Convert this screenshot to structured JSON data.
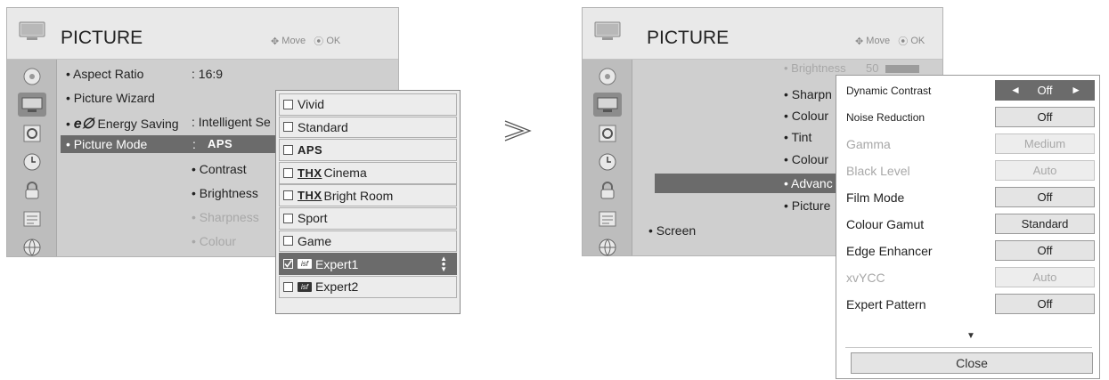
{
  "left": {
    "title": "PICTURE",
    "nav_hint": {
      "move": "Move",
      "ok": "OK"
    },
    "menu": {
      "aspect_ratio": {
        "label": "Aspect Ratio",
        "value": ": 16:9"
      },
      "picture_wizard": {
        "label": "Picture Wizard"
      },
      "energy_saving": {
        "prefix": "e∅",
        "label": "Energy Saving",
        "value": ": Intelligent Se"
      },
      "picture_mode": {
        "label": "Picture Mode",
        "value": ":",
        "value_logo": "APS"
      },
      "contrast": "• Contrast",
      "brightness": "• Brightness",
      "sharpness": "• Sharpness",
      "colour": "• Colour"
    }
  },
  "dropdown": {
    "options": [
      {
        "label": "Vivid",
        "checked": false,
        "selected": false
      },
      {
        "label": "Standard",
        "checked": false,
        "selected": false
      },
      {
        "label": "APS",
        "checked": false,
        "selected": false
      },
      {
        "logo": "THX",
        "label": "Cinema",
        "checked": false,
        "selected": false
      },
      {
        "logo": "THX",
        "label": " Bright Room",
        "checked": false,
        "selected": false
      },
      {
        "label": "Sport",
        "checked": false,
        "selected": false
      },
      {
        "label": "Game",
        "checked": false,
        "selected": false
      },
      {
        "logo": "isf",
        "label": "Expert1",
        "checked": true,
        "selected": true
      },
      {
        "logo": "isf",
        "label": "Expert2",
        "checked": false,
        "selected": false
      }
    ]
  },
  "right": {
    "title": "PICTURE",
    "nav_hint": {
      "move": "Move",
      "ok": "OK"
    },
    "menu": {
      "brightness": "• Brightness",
      "brightness_value": "50",
      "sharpness": "• Sharpn",
      "colour1": "• Colour",
      "tint": "• Tint",
      "colour2": "• Colour",
      "advanced": "• Advanc",
      "picture": "• Picture",
      "screen": "• Screen"
    }
  },
  "advanced": {
    "rows": [
      {
        "label": "Dynamic Contrast",
        "value": "Off",
        "active": true,
        "dim": false,
        "small": true
      },
      {
        "label": "Noise Reduction",
        "value": "Off",
        "active": false,
        "dim": false,
        "small": true
      },
      {
        "label": "Gamma",
        "value": "Medium",
        "active": false,
        "dim": true,
        "small": false
      },
      {
        "label": "Black Level",
        "value": "Auto",
        "active": false,
        "dim": true,
        "small": false
      },
      {
        "label": "Film Mode",
        "value": "Off",
        "active": false,
        "dim": false,
        "small": false
      },
      {
        "label": "Colour Gamut",
        "value": "Standard",
        "active": false,
        "dim": false,
        "small": false
      },
      {
        "label": "Edge Enhancer",
        "value": "Off",
        "active": false,
        "dim": false,
        "small": false
      },
      {
        "label": "xvYCC",
        "value": "Auto",
        "active": false,
        "dim": true,
        "small": false
      },
      {
        "label": "Expert Pattern",
        "value": "Off",
        "active": false,
        "dim": false,
        "small": false
      }
    ],
    "arrow_left": "◄",
    "arrow_right": "►",
    "close_label": "Close"
  },
  "icons": {
    "tv": "tv-icon",
    "sidebar": [
      "picture-disc-icon",
      "tv-icon",
      "audio-icon",
      "clock-icon",
      "lock-icon",
      "option-icon",
      "network-icon"
    ],
    "transition_arrow": "transition-arrow-icon"
  },
  "colors": {
    "highlight": "#6b6b6b",
    "panel": "#cfcfcf",
    "titlebar": "#e9e9e9"
  }
}
